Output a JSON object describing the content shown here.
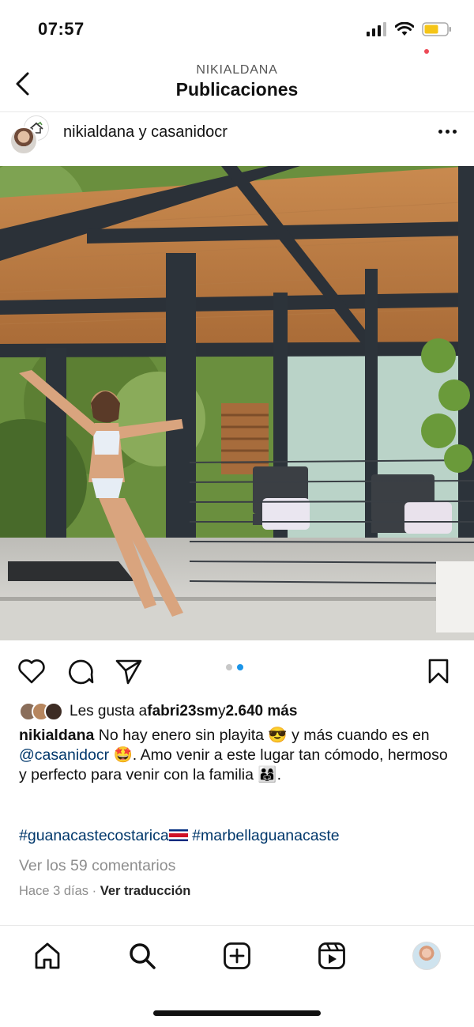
{
  "status_bar": {
    "time": "07:57",
    "icons": [
      "signal-icon",
      "wifi-icon",
      "battery-icon"
    ],
    "battery_color": "#f5c518"
  },
  "header": {
    "username": "NIKIALDANA",
    "title": "Publicaciones"
  },
  "post": {
    "authors": "nikialdana y casanidocr",
    "likes": {
      "prefix": "Les gusta a ",
      "user": "fabri23sm",
      "joiner": " y ",
      "count": "2.640 más"
    },
    "caption": {
      "username": "nikialdana",
      "text1": " No hay enero sin playita 😎 y más cuando es en ",
      "mention": "@casanidocr",
      "text2": " 🤩. Amo venir a este lugar tan cómodo, hermoso y perfecto para venir con la familia 👨‍👩‍👧."
    },
    "hashtags": {
      "tag1": "#guanacastecostarica",
      "tag2": "#marbellaguanacaste"
    },
    "comments_link": "Ver los 59 comentarios",
    "time_ago": "Hace 3 días",
    "separator": " · ",
    "translate": "Ver traducción",
    "carousel": {
      "current": 2,
      "total": 2
    }
  },
  "tabbar": {
    "items": [
      "home-icon",
      "search-icon",
      "create-icon",
      "reels-icon",
      "profile-avatar"
    ]
  },
  "colors": {
    "link": "#00376b",
    "secondary_text": "#8e8e8e",
    "carousel_active": "#1b95e8",
    "notification": "#ed4956"
  }
}
